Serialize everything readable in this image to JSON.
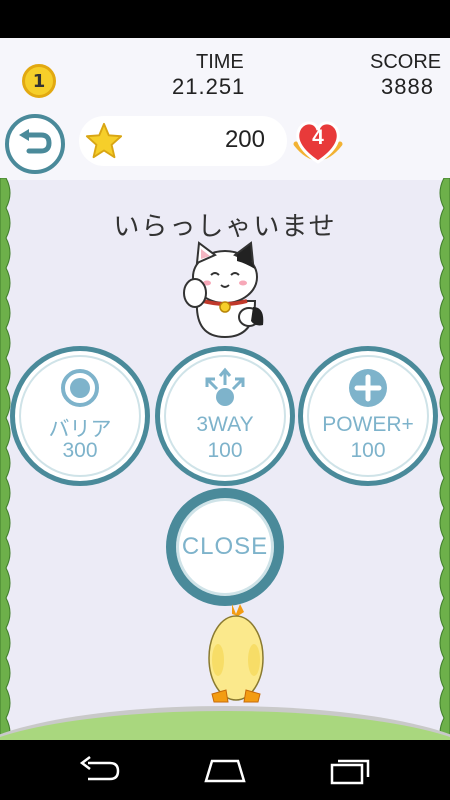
{
  "hud": {
    "level": "1",
    "time_label": "TIME",
    "time_value": "21.251",
    "score_label": "SCORE",
    "score_value": "3888",
    "stars": "200",
    "lives": "4"
  },
  "shop": {
    "greeting": "いらっしゃいませ",
    "items": [
      {
        "name": "バリア",
        "price": "300",
        "icon": "barrier-icon"
      },
      {
        "name": "3WAY",
        "price": "100",
        "icon": "three-way-icon"
      },
      {
        "name": "POWER+",
        "price": "100",
        "icon": "power-up-icon"
      }
    ],
    "close_label": "CLOSE"
  },
  "colors": {
    "button_ring": "#4a8a9a",
    "button_text": "#7eb3cb",
    "background": "#ecebf6",
    "coin": "#f6cf2a",
    "heart": "#e83a3a",
    "chick": "#fbe98c"
  }
}
